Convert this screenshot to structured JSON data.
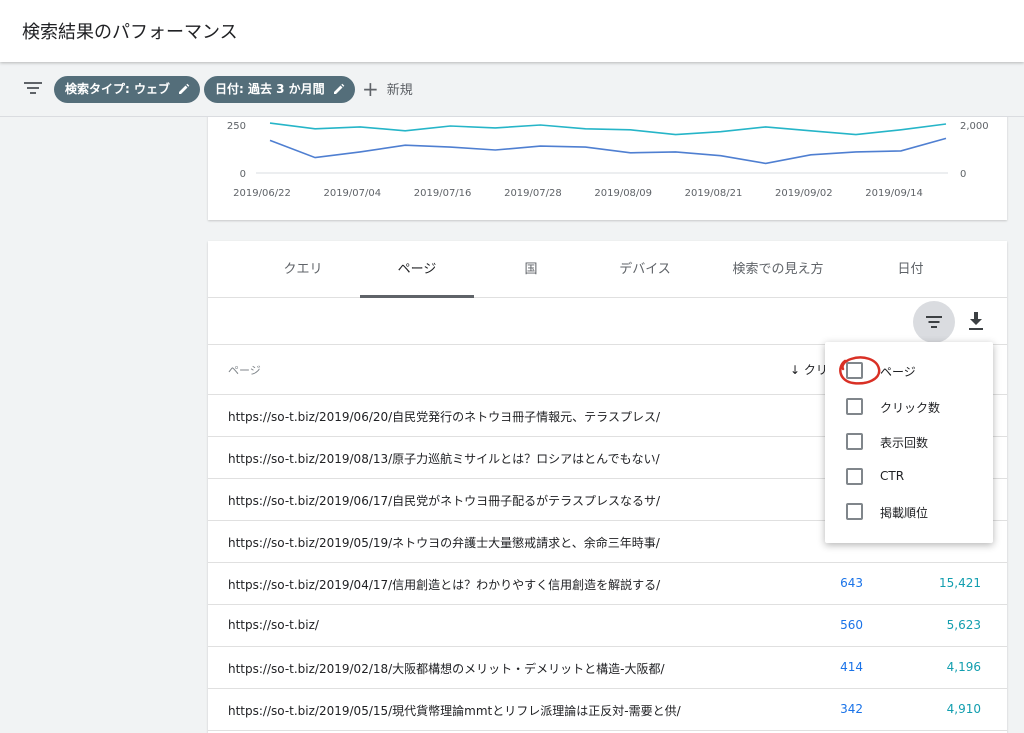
{
  "header": {
    "title": "検索結果のパフォーマンス"
  },
  "filters": {
    "chips": [
      {
        "label": "検索タイプ: ウェブ"
      },
      {
        "label": "日付: 過去 3 か月間"
      }
    ],
    "new_label": "新規"
  },
  "chart_data": {
    "type": "line",
    "x_ticks": [
      "2019/06/22",
      "2019/07/04",
      "2019/07/16",
      "2019/07/28",
      "2019/08/09",
      "2019/08/21",
      "2019/09/02",
      "2019/09/14"
    ],
    "y_left_ticks": [
      "250",
      "0"
    ],
    "y_right_ticks": [
      "2,000",
      "0"
    ],
    "series": [
      {
        "color": "#4f7fd1",
        "values": [
          170,
          80,
          110,
          145,
          135,
          120,
          140,
          135,
          105,
          110,
          90,
          50,
          95,
          110,
          115,
          180
        ]
      },
      {
        "color": "#26b5c8",
        "values": [
          260,
          230,
          240,
          220,
          245,
          235,
          250,
          230,
          225,
          200,
          215,
          240,
          220,
          200,
          225,
          255
        ]
      }
    ]
  },
  "tabs": [
    "クエリ",
    "ページ",
    "国",
    "デバイス",
    "検索での見え方",
    "日付"
  ],
  "table": {
    "col_page": "ページ",
    "col_clicks": "↓ クリ",
    "rows": [
      {
        "url": "https://so-t.biz/2019/06/20/自民党発行のネトウヨ冊子情報元、テラスプレス/",
        "clicks": "",
        "impressions": ""
      },
      {
        "url": "https://so-t.biz/2019/08/13/原子力巡航ミサイルとは？ロシアはとんでもない/",
        "clicks": "",
        "impressions": ""
      },
      {
        "url": "https://so-t.biz/2019/06/17/自民党がネトウヨ冊子配るがテラスプレスなるサ/",
        "clicks": "",
        "impressions": ""
      },
      {
        "url": "https://so-t.biz/2019/05/19/ネトウヨの弁護士大量懲戒請求と、余命三年時事/",
        "clicks": "",
        "impressions": ""
      },
      {
        "url": "https://so-t.biz/2019/04/17/信用創造とは？わかりやすく信用創造を解説する/",
        "clicks": "643",
        "impressions": "15,421"
      },
      {
        "url": "https://so-t.biz/",
        "clicks": "560",
        "impressions": "5,623"
      },
      {
        "url": "https://so-t.biz/2019/02/18/大阪都構想のメリット・デメリットと構造-大阪都/",
        "clicks": "414",
        "impressions": "4,196"
      },
      {
        "url": "https://so-t.biz/2019/05/15/現代貨幣理論mmtとリフレ派理論は正反対-需要と供/",
        "clicks": "342",
        "impressions": "4,910"
      }
    ]
  },
  "dropdown": {
    "items": [
      "ページ",
      "クリック数",
      "表示回数",
      "CTR",
      "掲載順位"
    ]
  },
  "colors": {
    "clicks": "#1a73e8",
    "impressions": "#129eaf",
    "chip": "#546e7a",
    "annotation": "#d93025"
  }
}
